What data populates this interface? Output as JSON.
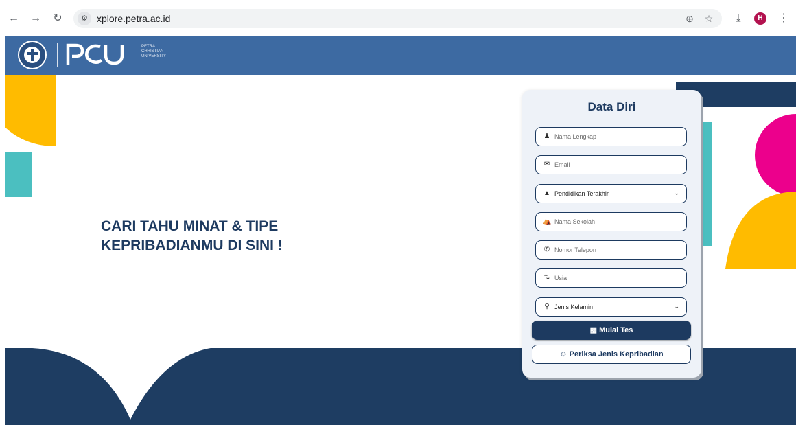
{
  "browser": {
    "url": "xplore.petra.ac.id",
    "profile_initial": "H",
    "icons": [
      "back-arrow-icon",
      "forward-arrow-icon",
      "reload-icon",
      "site-settings-icon",
      "zoom-icon",
      "bookmark-star-icon",
      "download-icon",
      "menu-kebab-icon"
    ]
  },
  "navbar": {
    "university_lines": [
      "PETRA",
      "CHRISTIAN",
      "UNIVERSITY"
    ],
    "color": "#3d6aa2"
  },
  "hero": {
    "line1": "CARI TAHU MINAT & TIPE",
    "line2": "KEPRIBADIANMU DI SINI !"
  },
  "form": {
    "title": "Data Diri",
    "fields": [
      {
        "icon": "user-icon",
        "placeholder": "Nama Lengkap",
        "type": "input"
      },
      {
        "icon": "envelope-icon",
        "placeholder": "Email",
        "type": "input"
      },
      {
        "icon": "graduation-cap-icon",
        "placeholder": "Pendidikan Terakhir",
        "type": "select"
      },
      {
        "icon": "institution-icon",
        "placeholder": "Nama Sekolah",
        "type": "input"
      },
      {
        "icon": "phone-icon",
        "placeholder": "Nomor Telepon",
        "type": "input"
      },
      {
        "icon": "sort-numeric-icon",
        "placeholder": "Usia",
        "type": "input"
      },
      {
        "icon": "gender-icon",
        "placeholder": "Jenis Kelamin",
        "type": "select"
      }
    ],
    "start_button": "Mulai Tes",
    "check_button": "Periksa Jenis Kepribadian"
  },
  "colors": {
    "navy": "#1d3a60",
    "yellow": "#ffbb00",
    "teal": "#4bbfc0",
    "pink": "#ec008c"
  }
}
